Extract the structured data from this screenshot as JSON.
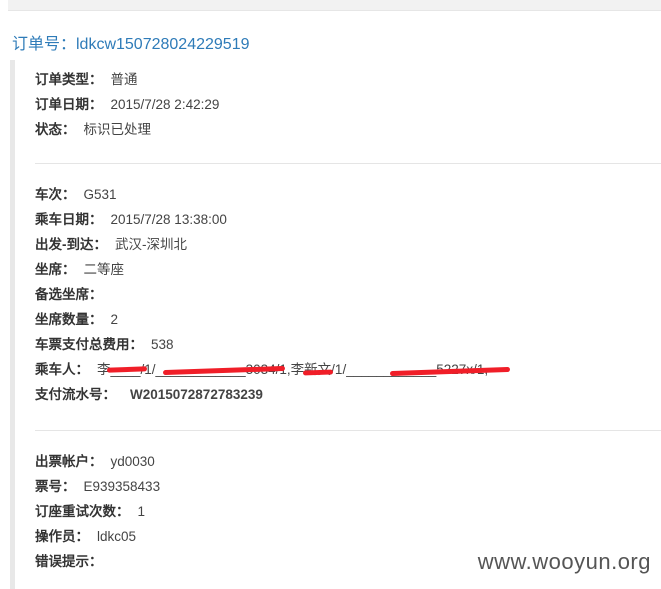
{
  "top_bar": {},
  "order": {
    "title": "订单号：ldkcw150728024229519"
  },
  "section1": {
    "type": {
      "label": "订单类型：",
      "value": "普通"
    },
    "date": {
      "label": "订单日期：",
      "value": "2015/7/28 2:42:29"
    },
    "status": {
      "label": "状态：",
      "value": "标识已处理"
    }
  },
  "section2": {
    "train": {
      "label": "车次：",
      "value": "G531"
    },
    "ride_date": {
      "label": "乘车日期：",
      "value": "2015/7/28 13:38:00"
    },
    "route": {
      "label": "出发-到达：",
      "value": "武汉-深圳北"
    },
    "seat": {
      "label": "坐席：",
      "value": "二等座"
    },
    "alt_seat": {
      "label": "备选坐席：",
      "value": ""
    },
    "seat_count": {
      "label": "坐席数量：",
      "value": "2"
    },
    "total_fee": {
      "label": "车票支付总费用：",
      "value": "538"
    },
    "passengers": {
      "label": "乘车人：",
      "value": "李____/1/____________3034/1,李新文/1/____________5227x/1,"
    },
    "payment_no": {
      "label": "支付流水号：",
      "value": "W2015072872783239"
    }
  },
  "section3": {
    "account": {
      "label": "出票帐户：",
      "value": "yd0030"
    },
    "ticket_no": {
      "label": "票号：",
      "value": "E939358433"
    },
    "retry_count": {
      "label": "订座重试次数：",
      "value": "1"
    },
    "operator": {
      "label": "操作员：",
      "value": "ldkc05"
    },
    "error": {
      "label": "错误提示：",
      "value": ""
    }
  },
  "watermark": "www.wooyun.org",
  "colors": {
    "title": "#2e7bb8",
    "redaction": "#f01e28",
    "panel_border": "#e8e8e8"
  }
}
